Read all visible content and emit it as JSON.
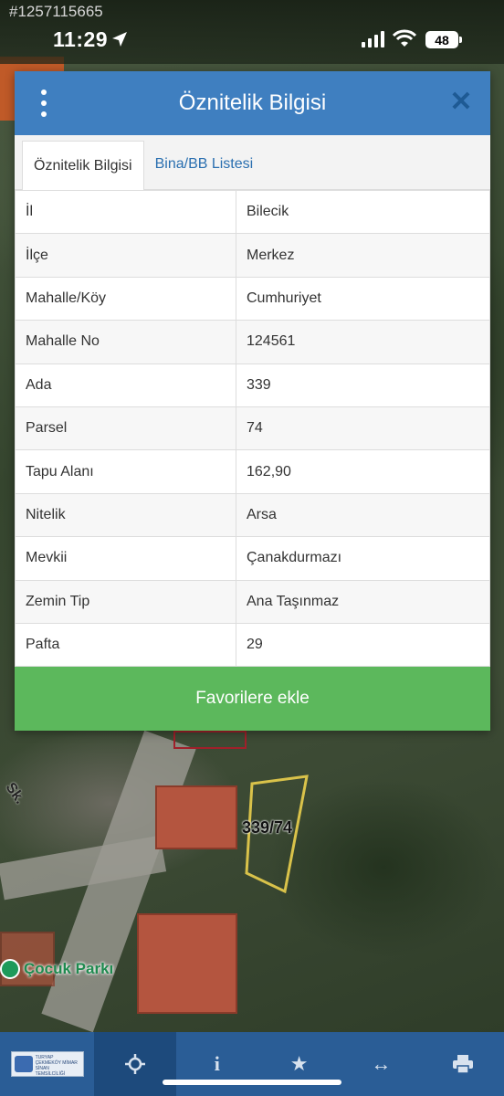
{
  "status_bar": {
    "corner_tag": "#1257115665",
    "time": "11:29",
    "battery": "48"
  },
  "map": {
    "parcel_label": "339/74",
    "poi_label": "Çocuk Parkı",
    "street_label": "Sk."
  },
  "dialog": {
    "title": "Öznitelik Bilgisi",
    "tabs": [
      {
        "label": "Öznitelik Bilgisi"
      },
      {
        "label": "Bina/BB Listesi"
      }
    ],
    "rows": [
      {
        "key": "İl",
        "value": "Bilecik"
      },
      {
        "key": "İlçe",
        "value": "Merkez"
      },
      {
        "key": "Mahalle/Köy",
        "value": "Cumhuriyet"
      },
      {
        "key": "Mahalle No",
        "value": "124561"
      },
      {
        "key": "Ada",
        "value": "339"
      },
      {
        "key": "Parsel",
        "value": "74"
      },
      {
        "key": "Tapu Alanı",
        "value": "162,90"
      },
      {
        "key": "Nitelik",
        "value": "Arsa"
      },
      {
        "key": "Mevkii",
        "value": "Çanakdurmazı"
      },
      {
        "key": "Zemin Tip",
        "value": "Ana Taşınmaz"
      },
      {
        "key": "Pafta",
        "value": "29"
      }
    ],
    "favorite_button": "Favorilere ekle"
  },
  "toolbar": {
    "logo_text": "TURYAP ÇEKMEKÖY MİMAR SİNAN TEMSİLCİLİĞİ",
    "items": [
      {
        "icon": "crosshair-icon"
      },
      {
        "icon": "info-icon",
        "glyph": "i"
      },
      {
        "icon": "star-icon",
        "glyph": "★"
      },
      {
        "icon": "measure-icon",
        "glyph": "↔"
      },
      {
        "icon": "print-icon"
      }
    ]
  },
  "colors": {
    "header": "#3f7fc0",
    "favorite": "#5cb85c",
    "toolbar": "#2a5d96",
    "tab_link": "#2a6fb0"
  }
}
